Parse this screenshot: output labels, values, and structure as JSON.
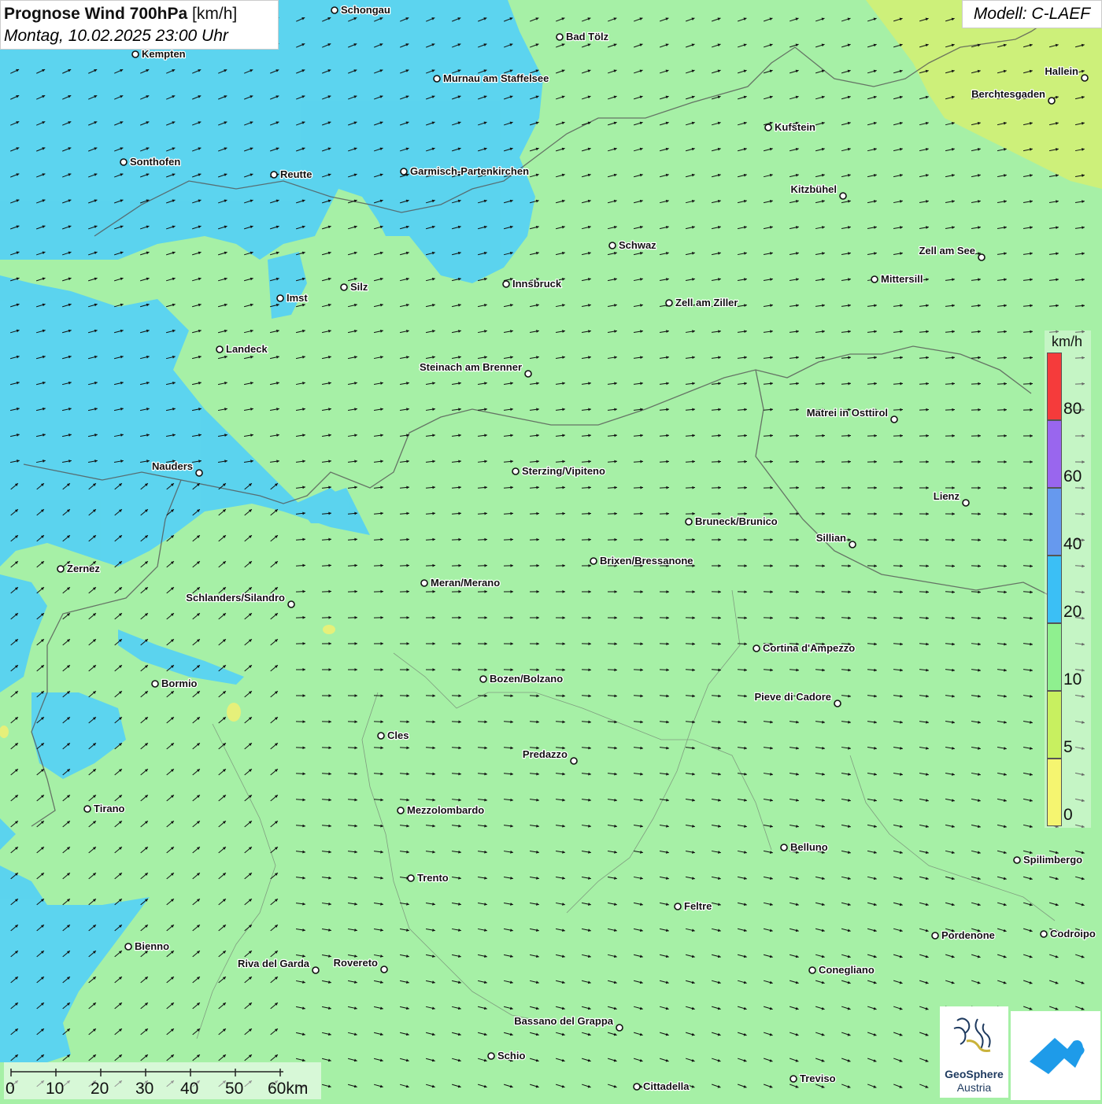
{
  "title": {
    "main": "Prognose Wind 700hPa",
    "unit": "[km/h]",
    "datetime": "Montag, 10.02.2025 23:00 Uhr"
  },
  "model": "Modell: C-LAEF",
  "legend": {
    "unit": "km/h",
    "bins": [
      {
        "from": 80,
        "color": "#f53b3b"
      },
      {
        "from": 60,
        "color": "#9966ee"
      },
      {
        "from": 40,
        "color": "#6699ee"
      },
      {
        "from": 20,
        "color": "#3bbff5"
      },
      {
        "from": 10,
        "color": "#8ff08f"
      },
      {
        "from": 5,
        "color": "#c8f060"
      },
      {
        "from": 0,
        "color": "#f5f570"
      }
    ],
    "labels": [
      "80",
      "60",
      "40",
      "20",
      "10",
      "5",
      "0"
    ]
  },
  "scale_bar": {
    "labels": [
      "0",
      "10",
      "20",
      "30",
      "40",
      "50",
      "60km"
    ]
  },
  "logos": {
    "geosphere_line1": "GeoSphere",
    "geosphere_line2": "Austria"
  },
  "cities": [
    {
      "name": "Schongau"
    },
    {
      "name": "Bad Tölz"
    },
    {
      "name": "Kempten"
    },
    {
      "name": "Murnau am Staffelsee"
    },
    {
      "name": "Hallein"
    },
    {
      "name": "Berchtesgaden"
    },
    {
      "name": "Kufstein"
    },
    {
      "name": "Sonthofen"
    },
    {
      "name": "Reutte"
    },
    {
      "name": "Garmisch-Partenkirchen"
    },
    {
      "name": "Kitzbühel"
    },
    {
      "name": "Schwaz"
    },
    {
      "name": "Zell am See"
    },
    {
      "name": "Innsbruck"
    },
    {
      "name": "Mittersill"
    },
    {
      "name": "Imst"
    },
    {
      "name": "Silz"
    },
    {
      "name": "Zell am Ziller"
    },
    {
      "name": "Landeck"
    },
    {
      "name": "Steinach am Brenner"
    },
    {
      "name": "Matrei in Osttirol"
    },
    {
      "name": "Nauders"
    },
    {
      "name": "Sterzing/Vipiteno"
    },
    {
      "name": "Lienz"
    },
    {
      "name": "Bruneck/Brunico"
    },
    {
      "name": "Sillian"
    },
    {
      "name": "Brixen/Bressanone"
    },
    {
      "name": "Zernez"
    },
    {
      "name": "Meran/Merano"
    },
    {
      "name": "Schlanders/Silandro"
    },
    {
      "name": "Cortina d'Ampezzo"
    },
    {
      "name": "Bozen/Bolzano"
    },
    {
      "name": "Bormio"
    },
    {
      "name": "Pieve di Cadore"
    },
    {
      "name": "Cles"
    },
    {
      "name": "Predazzo"
    },
    {
      "name": "Tirano"
    },
    {
      "name": "Mezzolombardo"
    },
    {
      "name": "Belluno"
    },
    {
      "name": "Spilimbergo"
    },
    {
      "name": "Trento"
    },
    {
      "name": "Feltre"
    },
    {
      "name": "Pordenone"
    },
    {
      "name": "Codroipo"
    },
    {
      "name": "Bienno"
    },
    {
      "name": "Riva del Garda"
    },
    {
      "name": "Rovereto"
    },
    {
      "name": "Conegliano"
    },
    {
      "name": "Bassano del Grappa"
    },
    {
      "name": "Schio"
    },
    {
      "name": "Treviso"
    },
    {
      "name": "Cittadella"
    }
  ]
}
